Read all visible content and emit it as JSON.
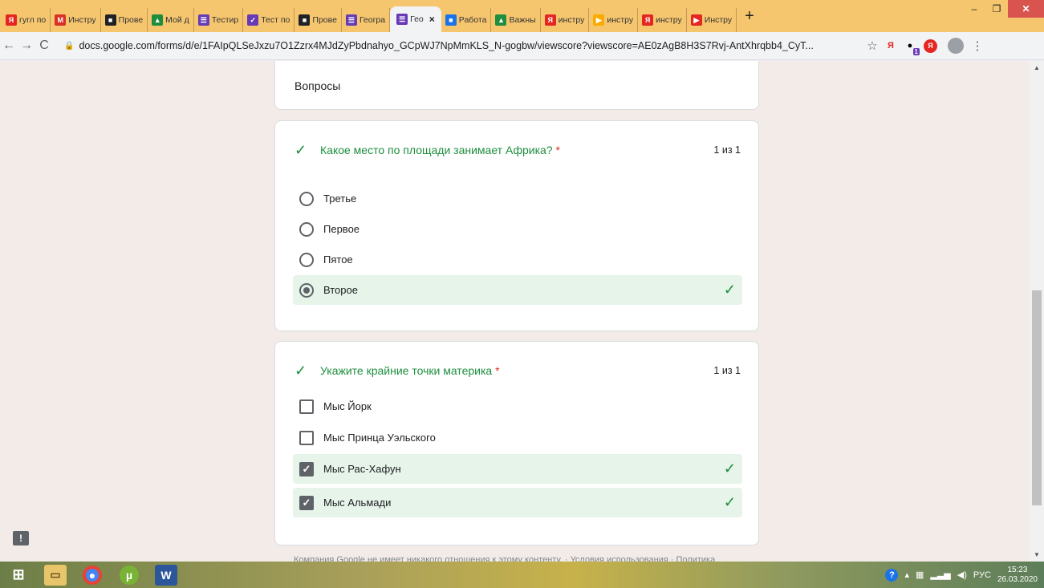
{
  "browser": {
    "tabs": [
      {
        "label": "гугл по",
        "favicon": "Я",
        "color": "#e52620"
      },
      {
        "label": "Инстру",
        "favicon": "M",
        "color": "#d93025"
      },
      {
        "label": "Прове",
        "favicon": "■",
        "color": "#202124"
      },
      {
        "label": "Мой д",
        "favicon": "▲",
        "color": "#1e8e3e"
      },
      {
        "label": "Тестир",
        "favicon": "☰",
        "color": "#673ab7"
      },
      {
        "label": "Тест по",
        "favicon": "✓",
        "color": "#673ab7"
      },
      {
        "label": "Прове",
        "favicon": "■",
        "color": "#202124"
      },
      {
        "label": "Геогра",
        "favicon": "☰",
        "color": "#673ab7"
      },
      {
        "label": "Гео",
        "favicon": "☰",
        "color": "#673ab7",
        "active": true
      },
      {
        "label": "Работа",
        "favicon": "■",
        "color": "#1a73e8"
      },
      {
        "label": "Важны",
        "favicon": "▲",
        "color": "#1e8e3e"
      },
      {
        "label": "инстру",
        "favicon": "Я",
        "color": "#e52620"
      },
      {
        "label": "инстру",
        "favicon": "▶",
        "color": "#f9ab00"
      },
      {
        "label": "инстру",
        "favicon": "Я",
        "color": "#e52620"
      },
      {
        "label": "Инстру",
        "favicon": "▶",
        "color": "#e52620"
      }
    ],
    "close_tab": "×",
    "new_tab": "+",
    "url": "docs.google.com/forms/d/e/1FAIpQLSeJxzu7O1Zzrx4MJdZyPbdnahyo_GCpWJ7NpMmKLS_N-gogbw/viewscore?viewscore=AE0zAgB8H3S7Rvj-AntXhrqbb4_CyT...",
    "ext_badge": "1"
  },
  "form": {
    "section_title": "Вопросы",
    "questions": [
      {
        "text": "Какое место по площади занимает Африка?",
        "required": "*",
        "score": "1 из 1",
        "options": [
          {
            "label": "Третье"
          },
          {
            "label": "Первое"
          },
          {
            "label": "Пятое"
          },
          {
            "label": "Второе"
          }
        ]
      },
      {
        "text": "Укажите крайние точки материка",
        "required": "*",
        "score": "1 из 1",
        "options": [
          {
            "label": "Мыс Йорк"
          },
          {
            "label": "Мыс Принца Уэльского"
          },
          {
            "label": "Мыс Рас-Хафун"
          },
          {
            "label": "Мыс Альмади"
          }
        ]
      }
    ],
    "footer": "Компания Google не имеет никакого отношения к этому контенту. · Условия использования · Политика"
  },
  "taskbar": {
    "lang": "РУС",
    "time": "15:23",
    "date": "26.03.2020"
  },
  "colors": {
    "correct": "#1e8e3e",
    "correct_bg": "#e6f4ea",
    "required": "#d93025"
  }
}
